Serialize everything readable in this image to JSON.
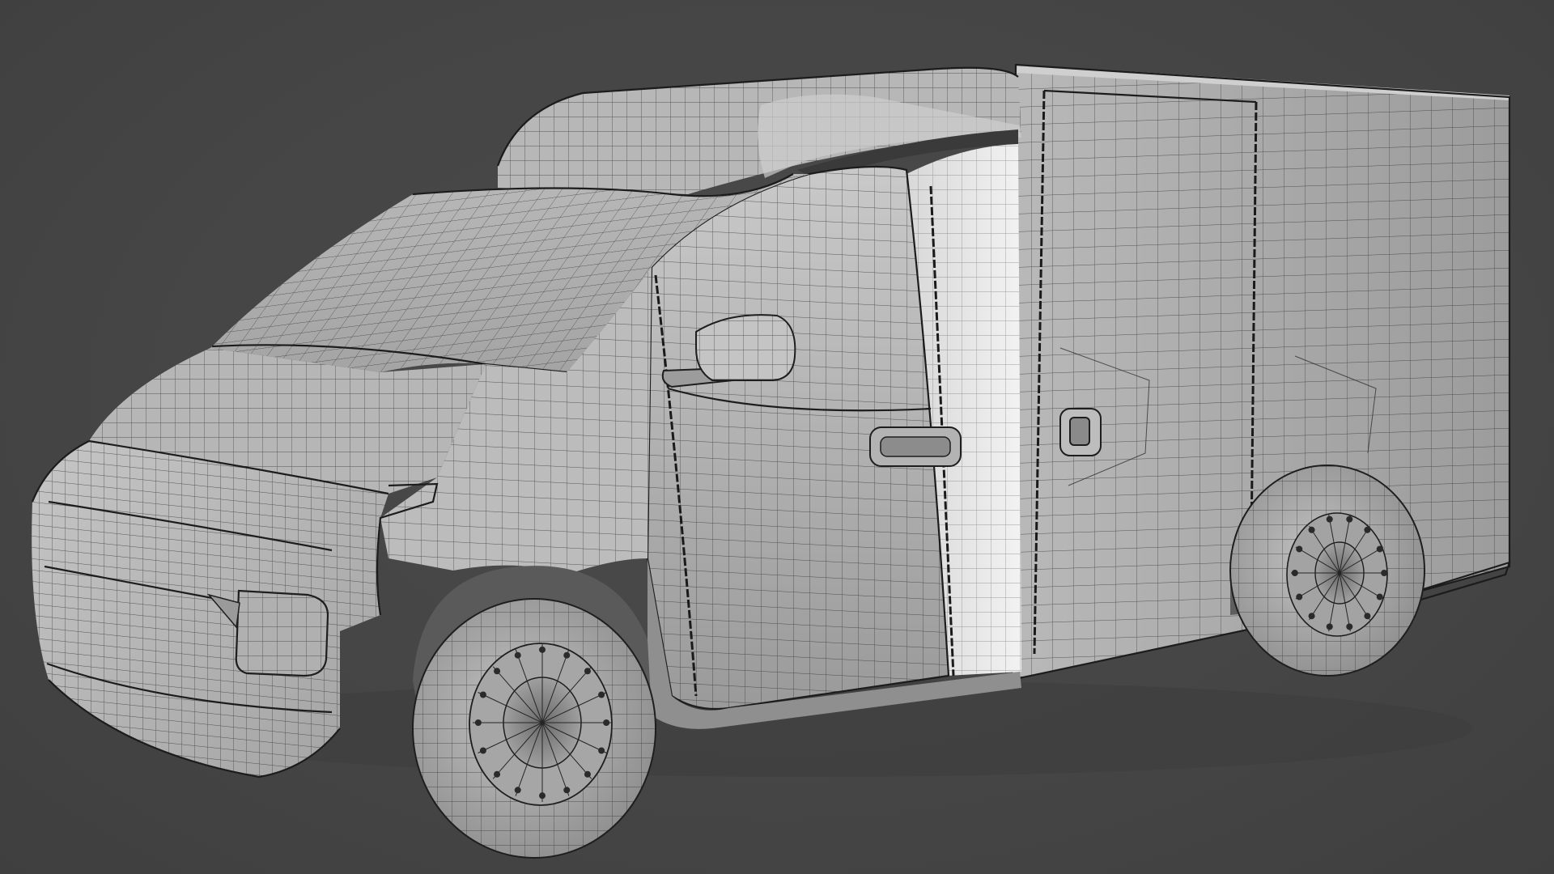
{
  "viewport": {
    "background_color": "#464646",
    "model_shade_light": "#d2d2d2",
    "model_shade_dark": "#8a8a8a",
    "wire_color": "#2a2a2a",
    "display_mode": "wireframe-on-shaded"
  },
  "model": {
    "subject": "box van",
    "parts": [
      "cab",
      "roof-fairing",
      "windshield",
      "side-mirror",
      "door-handle",
      "cargo-box",
      "cargo-latch",
      "headlight",
      "front-bumper",
      "front-wheel",
      "rear-wheel"
    ]
  }
}
